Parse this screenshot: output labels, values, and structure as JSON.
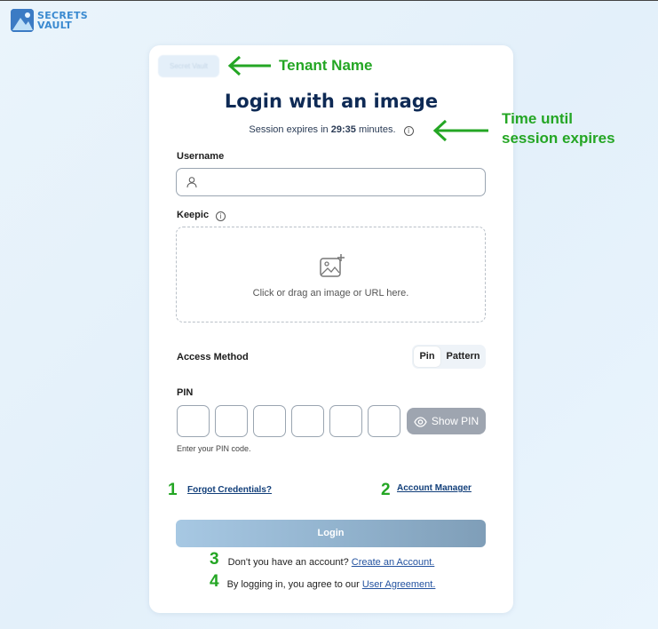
{
  "logo": {
    "line1": "SECRETS",
    "line2": "VAULT"
  },
  "tenant": {
    "name": "Secret Vault"
  },
  "title": "Login with an image",
  "session": {
    "prefix": "Session expires in",
    "time": "29:35",
    "suffix": "minutes."
  },
  "username": {
    "label": "Username",
    "value": "",
    "placeholder": ""
  },
  "keepic": {
    "label": "Keepic",
    "drop_text": "Click or drag an image or URL here."
  },
  "access_method": {
    "label": "Access Method",
    "options": [
      "Pin",
      "Pattern"
    ],
    "selected": "Pin"
  },
  "pin": {
    "label": "PIN",
    "show_label": "Show PIN",
    "hint": "Enter your PIN code."
  },
  "links": {
    "forgot": "Forgot Credentials?",
    "account_manager": "Account Manager"
  },
  "login_button": "Login",
  "signup": {
    "text": "Don't you have an account?",
    "link": "Create an Account."
  },
  "agreement": {
    "text": "By logging in, you agree to our",
    "link": "User Agreement."
  },
  "annotations": {
    "tenant": "Tenant Name",
    "session_line1": "Time until",
    "session_line2": "session expires",
    "n1": "1",
    "n2": "2",
    "n3": "3",
    "n4": "4"
  },
  "colors": {
    "annotation": "#24a624",
    "title": "#0e2a55",
    "link": "#123f7a"
  }
}
